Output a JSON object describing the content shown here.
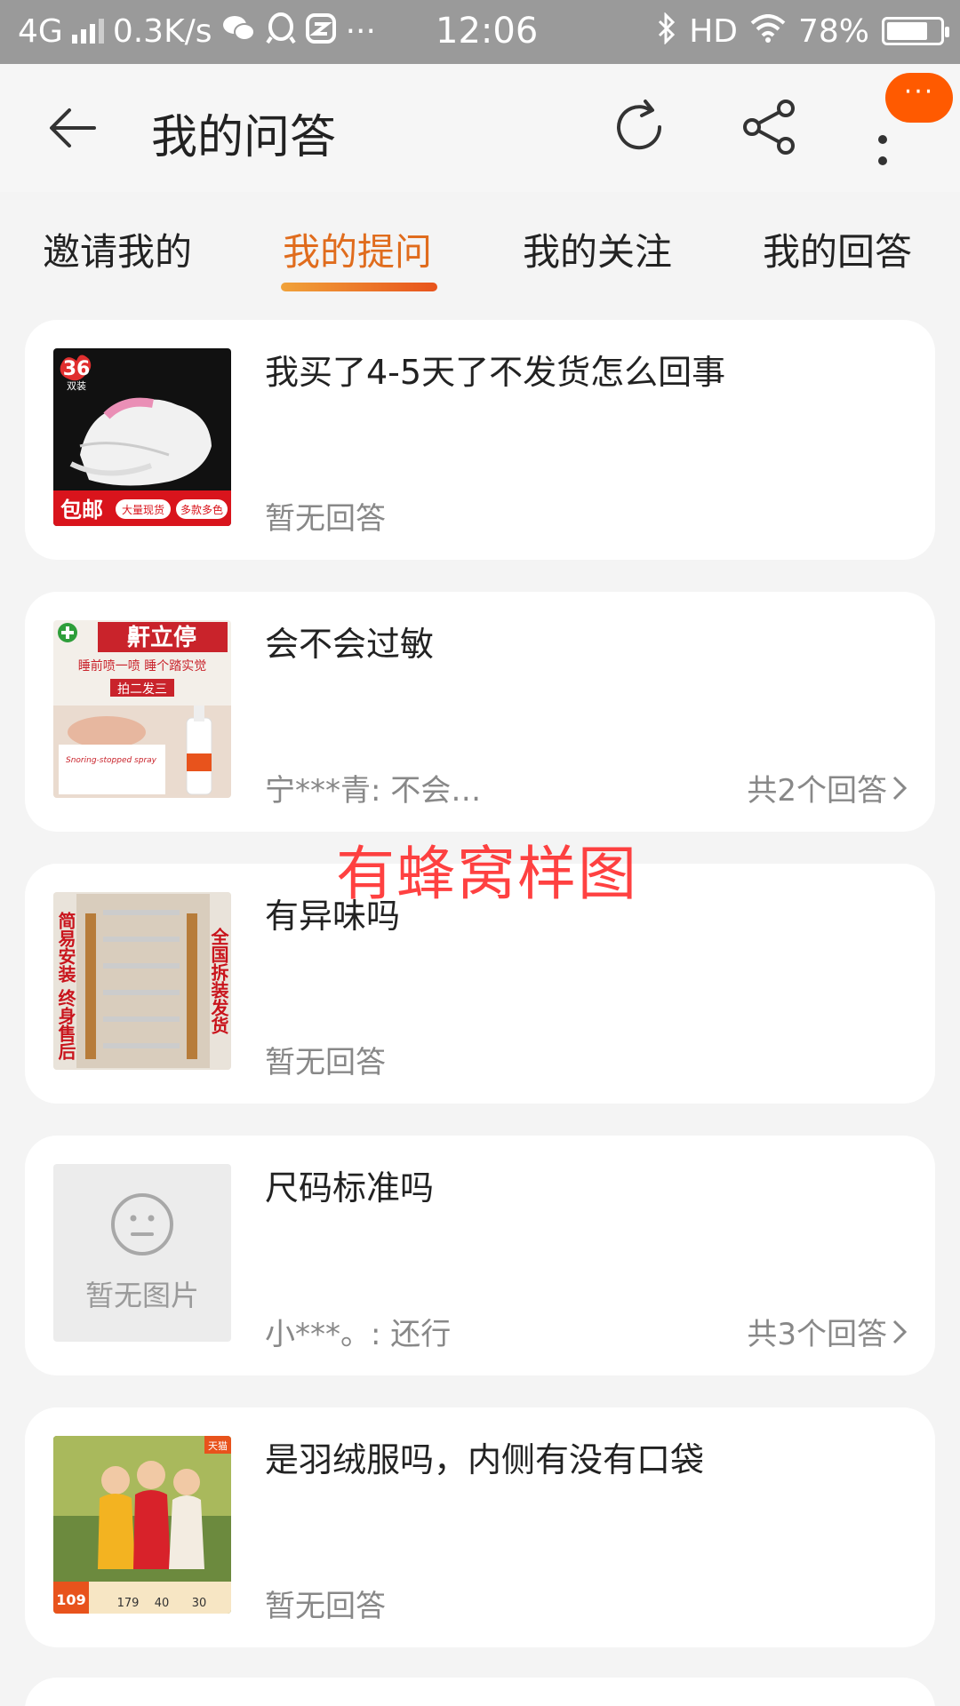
{
  "status_bar": {
    "network": "4G",
    "speed": "0.3K/s",
    "more": "···",
    "time": "12:06",
    "hd": "HD",
    "battery_percent": "78%",
    "battery_level": 0.78,
    "icons": [
      "wechat-icon",
      "qq-icon",
      "app-icon",
      "bluetooth-icon",
      "wifi-icon",
      "battery-icon"
    ]
  },
  "header": {
    "title": "我的问答",
    "message_badge": "···"
  },
  "tabs": [
    {
      "label": "邀请我的",
      "active": false
    },
    {
      "label": "我的提问",
      "active": true
    },
    {
      "label": "我的关注",
      "active": false
    },
    {
      "label": "我的回答",
      "active": false
    }
  ],
  "accent_color": "#e06c1d",
  "questions": [
    {
      "question": "我买了4-5天了不发货怎么回事",
      "answer": "暂无回答",
      "count": "",
      "thumb": {
        "badge": "36",
        "badge_sub": "双装",
        "tag_main": "包邮",
        "tag_1": "大量现货",
        "tag_2": "多款多色"
      }
    },
    {
      "question": "会不会过敏",
      "answer": "宁***青: 不会…",
      "count": "共2个回答",
      "thumb": {
        "brand": "鼾立停",
        "sub": "睡前喷一喷 睡个踏实觉",
        "tag": "拍二发三",
        "spray": "Snoring-stopped spray"
      }
    },
    {
      "question": "有异味吗",
      "answer": "暂无回答",
      "count": "",
      "thumb": {
        "left_text": "简易安装 终身售后",
        "right_text": "全国拆装发货"
      }
    },
    {
      "question": "尺码标准吗",
      "answer": "小***。: 还行",
      "count": "共3个回答",
      "thumb": {
        "placeholder": "暂无图片"
      }
    },
    {
      "question": "是羽绒服吗，内侧有没有口袋",
      "answer": "暂无回答",
      "count": "",
      "thumb": {
        "price": "109",
        "tag": "天猫",
        "stats": [
          "179",
          "40",
          "30"
        ]
      }
    }
  ],
  "watermark": "有蜂窝样图"
}
